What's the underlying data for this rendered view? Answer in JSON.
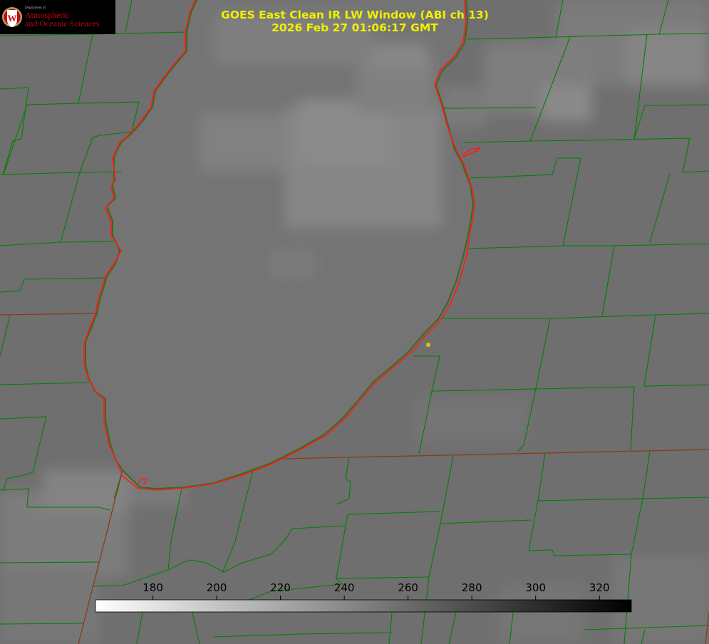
{
  "header": {
    "title": "GOES East Clean IR LW Window (ABI ch 13)",
    "timestamp": "2026 Feb 27 01:06:17 GMT"
  },
  "logo": {
    "department": "Department of",
    "line1": "Atmospheric",
    "line2": "and Oceanic Sciences",
    "seal_letter": "W",
    "seal_color": "#c5050c"
  },
  "colorbar": {
    "units": "",
    "ticks": [
      180,
      200,
      220,
      240,
      260,
      280,
      300,
      320
    ],
    "range": [
      162,
      330
    ],
    "gradient": "white-to-black"
  },
  "map": {
    "county_line_color": "#008000",
    "state_line_color": "#8b3a1a",
    "coastline_color": "#ff0000",
    "marker_color": "#d8c800",
    "background_gray": "#6f6f6f",
    "lake_gray": "#737373"
  }
}
